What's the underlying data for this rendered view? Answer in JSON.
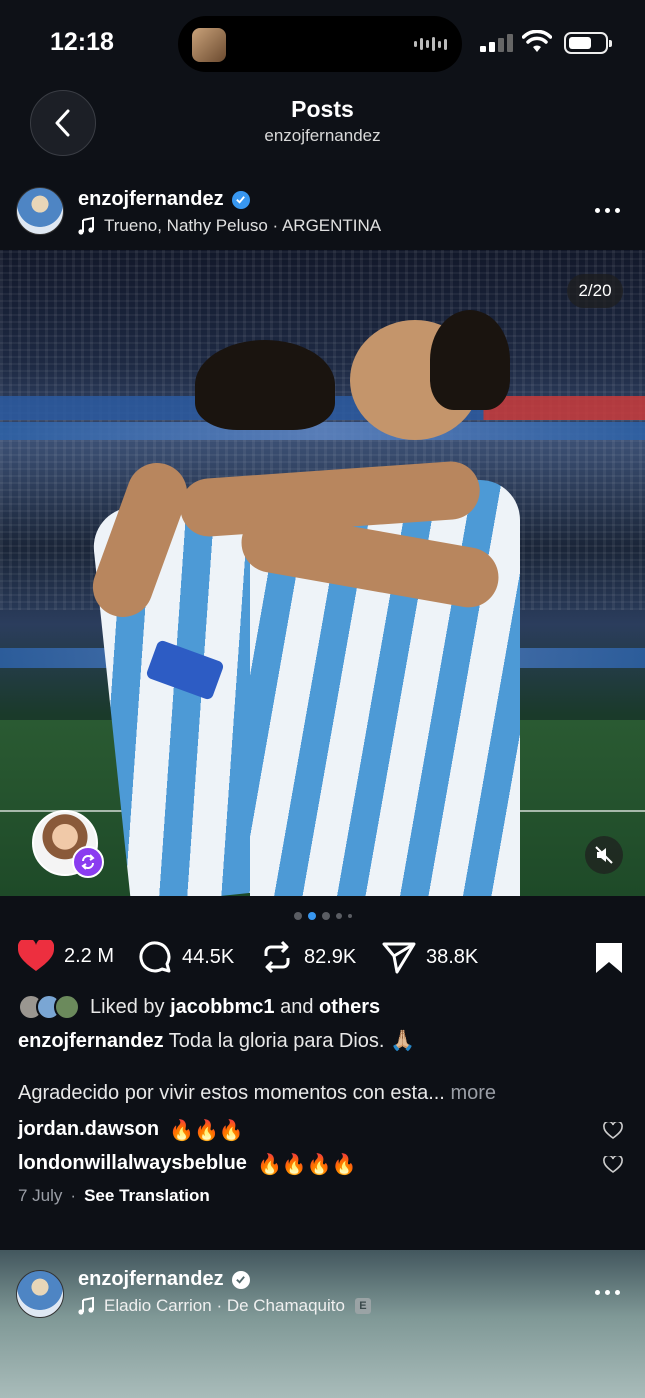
{
  "status_bar": {
    "time": "12:18"
  },
  "header": {
    "title": "Posts",
    "subtitle": "enzojfernandez"
  },
  "post": {
    "username": "enzojfernandez",
    "music": "Trueno, Nathy Peluso · ARGENTINA",
    "counter": "2/20",
    "likes": "2.2 M",
    "comments": "44.5K",
    "reposts": "82.9K",
    "shares": "38.8K",
    "liked_by_prefix": "Liked by",
    "liked_by_user": "jacobbmc1",
    "liked_by_and": "and",
    "liked_by_others": "others",
    "caption_user": "enzojfernandez",
    "caption_text": "Toda la gloria para Dios. 🙏🏼",
    "caption_body": "Agradecido por vivir estos momentos con esta...",
    "more_label": "more",
    "comments_list": [
      {
        "user": "jordan.dawson",
        "text": "🔥🔥🔥"
      },
      {
        "user": "londonwillalwaysbeblue",
        "text": "🔥🔥🔥🔥"
      }
    ],
    "date": "7 July",
    "separator": "·",
    "see_translation": "See Translation"
  },
  "next_post": {
    "username": "enzojfernandez",
    "music": "Eladio Carrion · De Chamaquito",
    "explicit": "E"
  },
  "colors": {
    "accent": "#3897f0",
    "like_red": "#ed2f3f",
    "repost_purple": "#8a3cf0"
  }
}
